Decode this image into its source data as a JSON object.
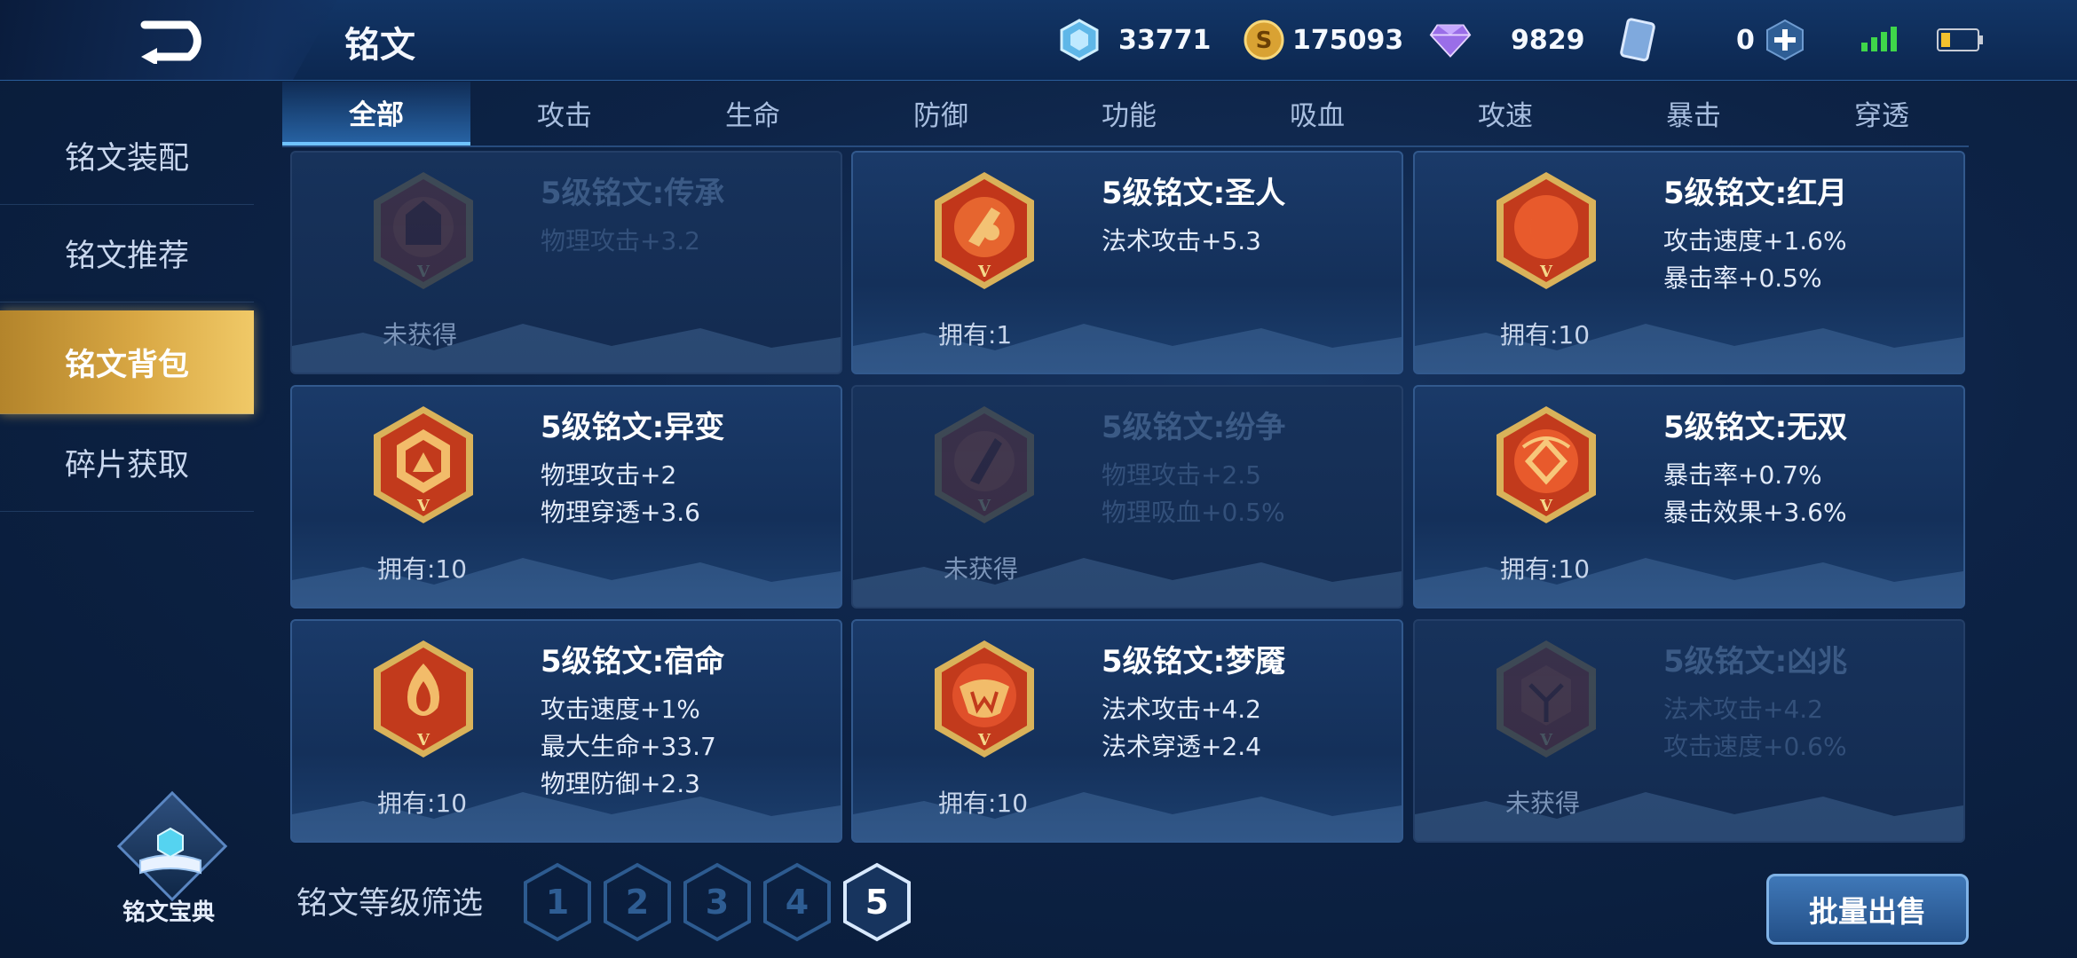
{
  "header": {
    "title": "铭文",
    "currencies": [
      {
        "icon": "diamond-icon",
        "value": "33771"
      },
      {
        "icon": "gold-coin-icon",
        "value": "175093"
      },
      {
        "icon": "gem-icon",
        "value": "9829"
      },
      {
        "icon": "ticket-card-icon",
        "value": "0"
      }
    ]
  },
  "sidebar": {
    "items": [
      {
        "label": "铭文装配"
      },
      {
        "label": "铭文推荐"
      },
      {
        "label": "铭文背包"
      },
      {
        "label": "碎片获取"
      }
    ],
    "active_index": 2,
    "codex_label": "铭文宝典"
  },
  "tabs": [
    {
      "label": "全部"
    },
    {
      "label": "攻击"
    },
    {
      "label": "生命"
    },
    {
      "label": "防御"
    },
    {
      "label": "功能"
    },
    {
      "label": "吸血"
    },
    {
      "label": "攻速"
    },
    {
      "label": "暴击"
    },
    {
      "label": "穿透"
    }
  ],
  "active_tab": 0,
  "inscriptions": [
    {
      "name": "5级铭文:传承",
      "attrs": [
        "物理攻击+3.2"
      ],
      "owned": "未获得",
      "locked": true
    },
    {
      "name": "5级铭文:圣人",
      "attrs": [
        "法术攻击+5.3"
      ],
      "owned": "拥有:1",
      "locked": false
    },
    {
      "name": "5级铭文:红月",
      "attrs": [
        "攻击速度+1.6%",
        "暴击率+0.5%"
      ],
      "owned": "拥有:10",
      "locked": false
    },
    {
      "name": "5级铭文:异变",
      "attrs": [
        "物理攻击+2",
        "物理穿透+3.6"
      ],
      "owned": "拥有:10",
      "locked": false
    },
    {
      "name": "5级铭文:纷争",
      "attrs": [
        "物理攻击+2.5",
        "物理吸血+0.5%"
      ],
      "owned": "未获得",
      "locked": true
    },
    {
      "name": "5级铭文:无双",
      "attrs": [
        "暴击率+0.7%",
        "暴击效果+3.6%"
      ],
      "owned": "拥有:10",
      "locked": false
    },
    {
      "name": "5级铭文:宿命",
      "attrs": [
        "攻击速度+1%",
        "最大生命+33.7",
        "物理防御+2.3"
      ],
      "owned": "拥有:10",
      "locked": false
    },
    {
      "name": "5级铭文:梦魇",
      "attrs": [
        "法术攻击+4.2",
        "法术穿透+2.4"
      ],
      "owned": "拥有:10",
      "locked": false
    },
    {
      "name": "5级铭文:凶兆",
      "attrs": [
        "法术攻击+4.2",
        "攻击速度+0.6%"
      ],
      "owned": "未获得",
      "locked": true
    }
  ],
  "badge_numeral": "V",
  "footer": {
    "filter_label": "铭文等级筛选",
    "levels": [
      "1",
      "2",
      "3",
      "4",
      "5"
    ],
    "active_level": "5",
    "batch_sell_label": "批量出售"
  },
  "colors": {
    "accent_gold": "#d9a844",
    "accent_blue": "#6fc3ff",
    "status_green": "#3fd64a",
    "battery_yellow": "#f2c12e"
  }
}
